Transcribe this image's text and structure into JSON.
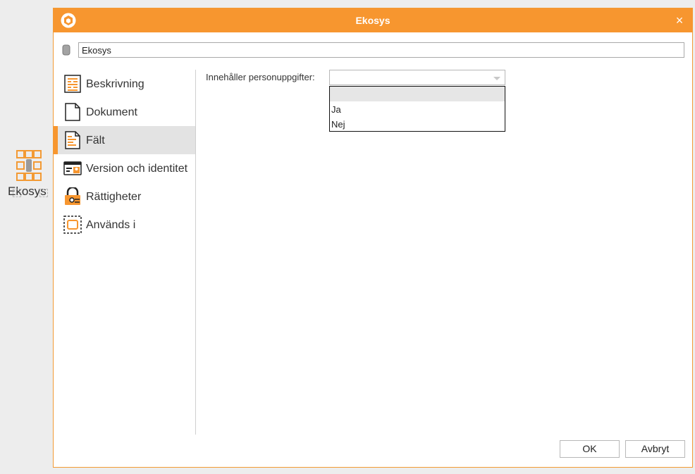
{
  "canvas": {
    "node_label": "Ekosys"
  },
  "dialog": {
    "title": "Ekosys",
    "close_glyph": "×",
    "name_value": "Ekosys",
    "accent_color": "#f7962f"
  },
  "sidebar": {
    "items": [
      {
        "label": "Beskrivning",
        "icon": "description-icon",
        "active": false
      },
      {
        "label": "Dokument",
        "icon": "document-icon",
        "active": false
      },
      {
        "label": "Fält",
        "icon": "fields-icon",
        "active": true
      },
      {
        "label": "Version och identitet",
        "icon": "id-card-icon",
        "active": false
      },
      {
        "label": "Rättigheter",
        "icon": "lock-icon",
        "active": false
      },
      {
        "label": "Används i",
        "icon": "used-in-icon",
        "active": false
      }
    ]
  },
  "fields": {
    "personal_data_label": "Innehåller personuppgifter:",
    "personal_data_value": "",
    "options": [
      "",
      "Ja",
      "Nej"
    ],
    "highlighted_option": ""
  },
  "buttons": {
    "ok": "OK",
    "cancel": "Avbryt"
  }
}
